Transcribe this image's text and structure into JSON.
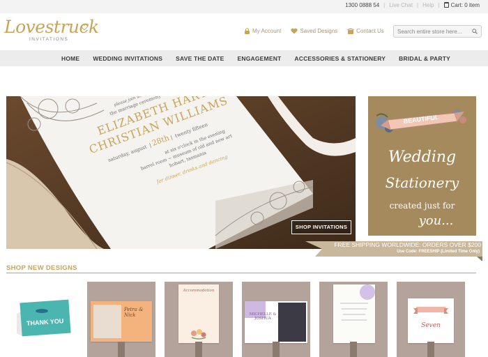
{
  "topbar": {
    "phone": "1300 0888 54",
    "live_chat": "Live Chat",
    "help": "Help",
    "cart": "Cart: 0 item"
  },
  "header": {
    "logo_script": "Lovestruck",
    "logo_sub": "INVITATIONS",
    "my_account": "My Account",
    "saved_designs": "Saved Designs",
    "contact_us": "Contact Us",
    "search_placeholder": "Search entire store here..."
  },
  "nav": {
    "items": [
      "HOME",
      "WEDDING INVITATIONS",
      "SAVE THE DATE",
      "ENGAGEMENT",
      "ACCESSORIES & STATIONERY",
      "BRIDAL & PARTY"
    ]
  },
  "hero": {
    "invite_line1": "please join us to celebrate",
    "invite_line2": "the marriage ceremony of",
    "name1": "ELIZABETH HART",
    "name2": "CHRISTIAN WILLIAMS",
    "date_day": "saturday, august",
    "date_num": "28th",
    "date_year": "twenty fifteen",
    "time": "at six o'clock in the evening",
    "venue1": "barrel room ~ museum of old and new art",
    "venue2": "hobart, tasmania",
    "dinner": "for dinner, drinks and dancing",
    "button": "SHOP INVITATIONS"
  },
  "promo": {
    "banner": "BEAUTIFUL",
    "line1": "Wedding",
    "line2": "Stationery",
    "line3": "created just for",
    "line4": "you..."
  },
  "shipping": {
    "headline": "FREE SHIPPING WORLDWIDE: ORDERS OVER $200",
    "code": "Use Code: FREESHIP (Limited Time Only)"
  },
  "section": {
    "title": "SHOP NEW DESIGNS"
  },
  "products": {
    "thank_you": "THANK YOU",
    "card2_names": "Petra & Nick",
    "card3_title": "Accommodation",
    "card4_names": "MICHELLE & JOSHUA",
    "card6_word": "Seven"
  },
  "colors": {
    "gold": "#c8a45a",
    "promo_bg": "#a58a5d",
    "nav_bg": "#ececec",
    "ribbon": "#c9b79b"
  }
}
